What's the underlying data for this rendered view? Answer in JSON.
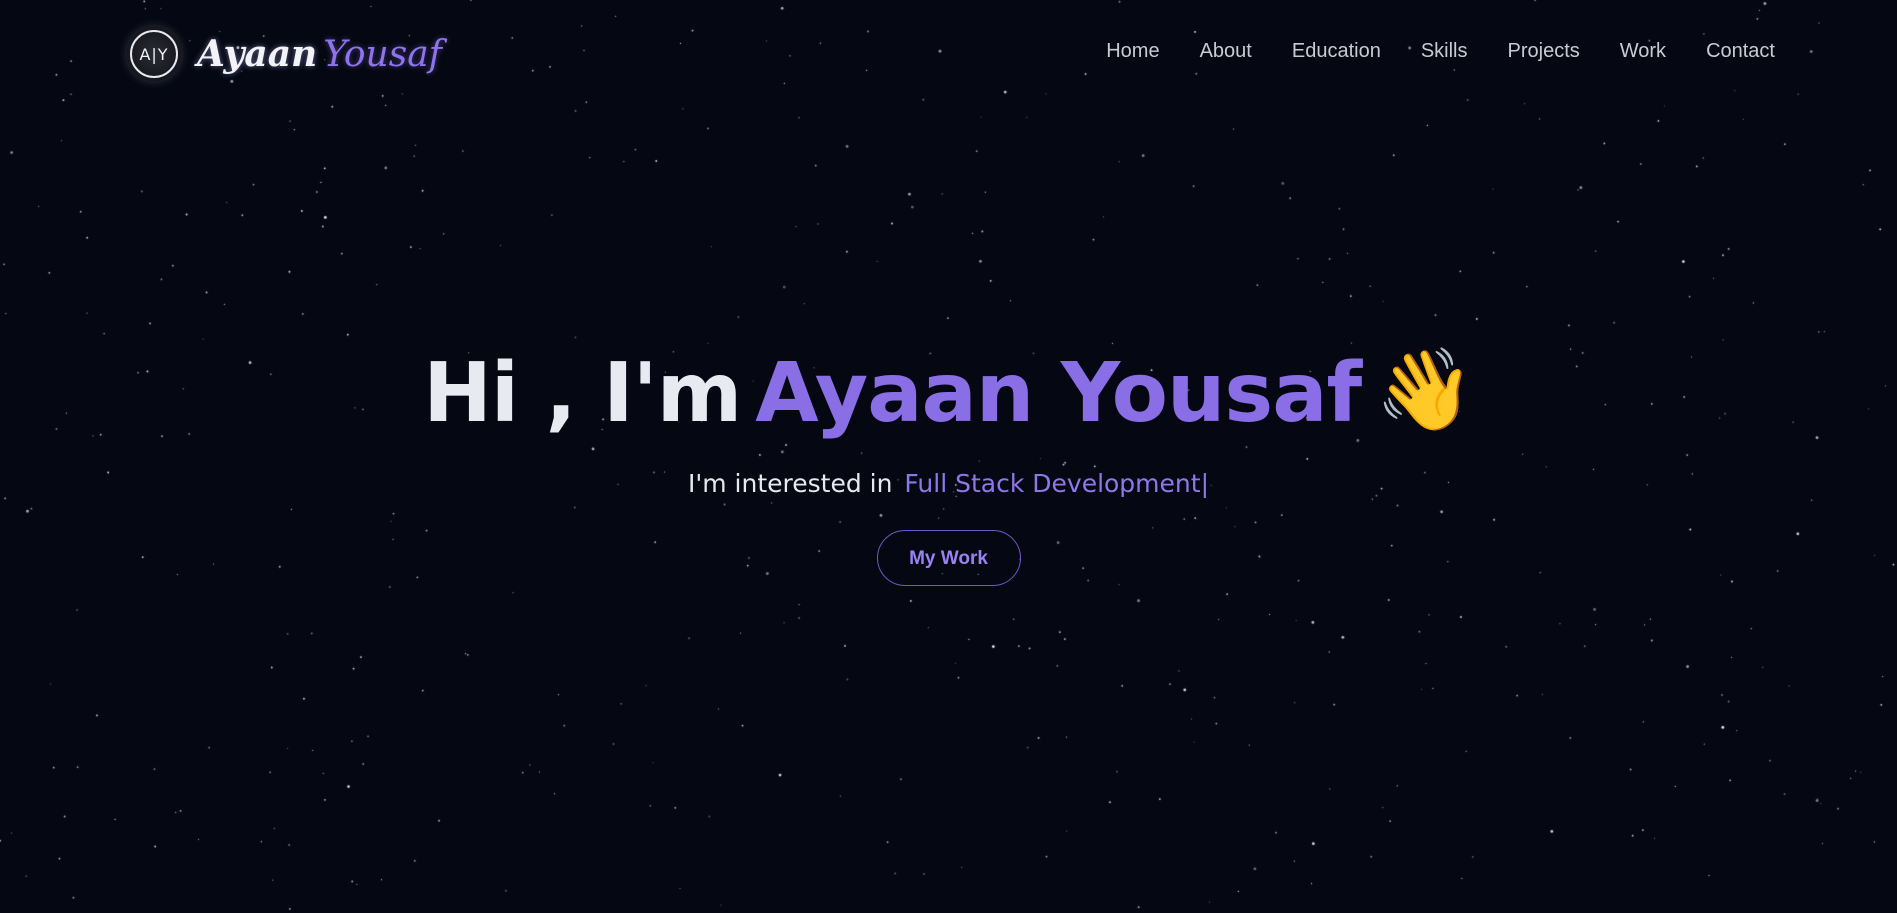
{
  "brand": {
    "logo_text": "A|Y",
    "first_name": "Ayaan",
    "last_name": "Yousaf"
  },
  "nav": {
    "items": [
      {
        "label": "Home"
      },
      {
        "label": "About"
      },
      {
        "label": "Education"
      },
      {
        "label": "Skills"
      },
      {
        "label": "Projects"
      },
      {
        "label": "Work"
      },
      {
        "label": "Contact"
      }
    ]
  },
  "hero": {
    "greeting": "Hi , I'm",
    "name": "Ayaan Yousaf",
    "wave_emoji": "👋",
    "subtitle_prefix": "I'm interested in",
    "subtitle_highlight": "Full Stack Development",
    "cursor": "|",
    "cta_label": "My Work"
  },
  "colors": {
    "background": "#050812",
    "accent": "#8a6ee6",
    "nav_text": "#c9cad4",
    "heading_text": "#e8eaf2"
  },
  "icons": {
    "logo": "ay-monogram-icon",
    "wave": "waving-hand-icon"
  }
}
